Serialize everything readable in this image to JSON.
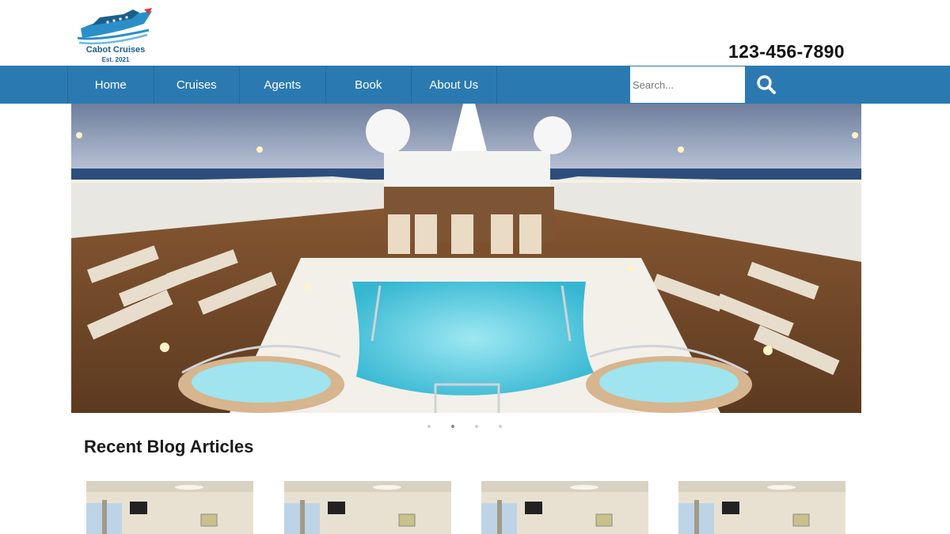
{
  "brand": {
    "name": "Cabot Cruises",
    "established": "Est. 2021"
  },
  "header": {
    "phone": "123-456-7890"
  },
  "nav": {
    "items": [
      {
        "label": "Home"
      },
      {
        "label": "Cruises"
      },
      {
        "label": "Agents"
      },
      {
        "label": "Book"
      },
      {
        "label": "About Us"
      }
    ]
  },
  "search": {
    "placeholder": "Search...",
    "icon": "search-icon"
  },
  "hero": {
    "image": "cruise ship pool deck",
    "slides": 4,
    "active_slide": 2
  },
  "blog": {
    "heading": "Recent Blog Articles",
    "cards": [
      {
        "image": "ship-interior"
      },
      {
        "image": "ship-interior"
      },
      {
        "image": "ship-interior"
      },
      {
        "image": "ship-interior"
      }
    ]
  },
  "colors": {
    "nav_bg": "#2a7ab1",
    "brand": "#1b5f8c",
    "pool": "#5fd0e3"
  }
}
